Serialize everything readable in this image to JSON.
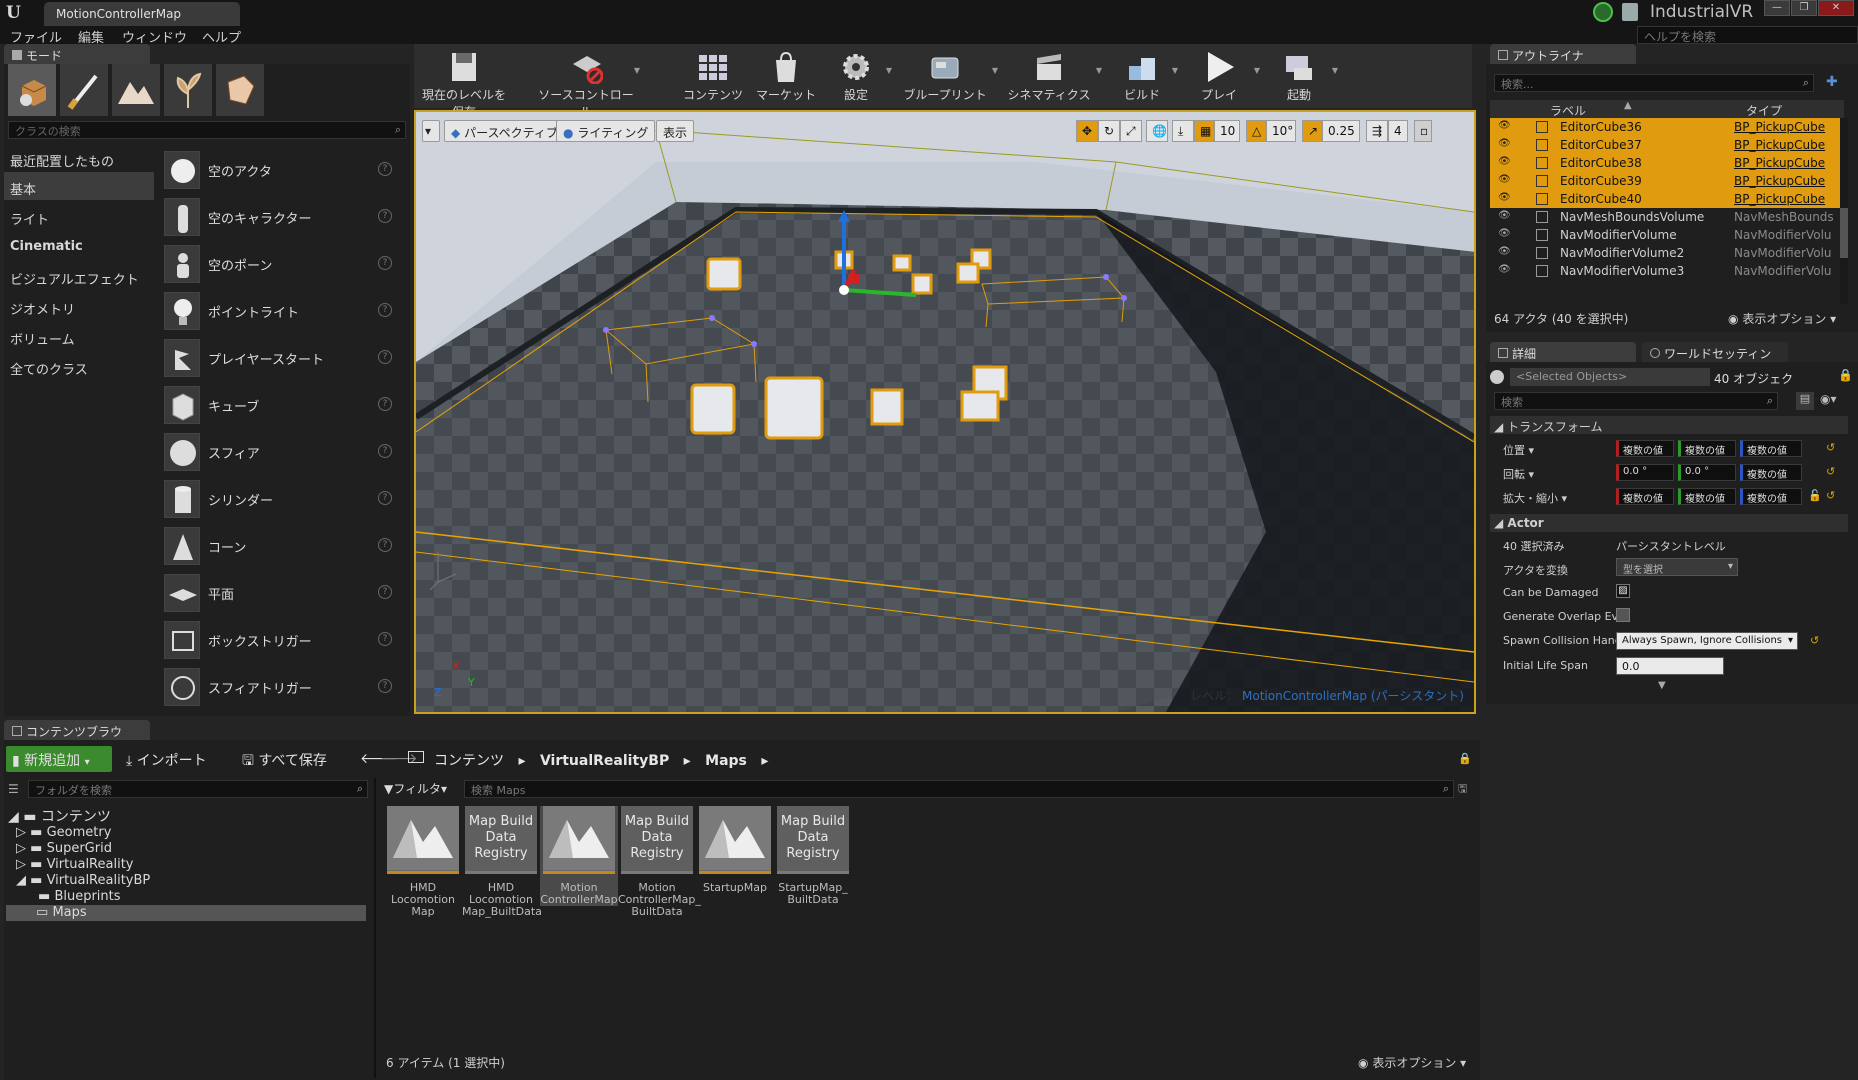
{
  "titlebar": {
    "document_tab": "MotionControllerMap",
    "project_name": "IndustrialVR"
  },
  "menu": [
    "ファイル",
    "編集",
    "ウィンドウ",
    "ヘルプ"
  ],
  "help_search_placeholder": "ヘルプを検索",
  "modes": {
    "tab": "モード",
    "class_search_placeholder": "クラスの検索",
    "categories": [
      "最近配置したもの",
      "基本",
      "ライト",
      "Cinematic",
      "ビジュアルエフェクト",
      "ジオメトリ",
      "ボリューム",
      "全てのクラス"
    ],
    "selected_category": "基本",
    "items": [
      "空のアクタ",
      "空のキャラクター",
      "空のポーン",
      "ポイントライト",
      "プレイヤースタート",
      "キューブ",
      "スフィア",
      "シリンダー",
      "コーン",
      "平面",
      "ボックストリガー",
      "スフィアトリガー"
    ],
    "help_glyph": "?"
  },
  "toolbar": {
    "buttons": [
      "現在のレベルを保存",
      "ソースコントロール",
      "コンテンツ",
      "マーケット",
      "設定",
      "ブループリント",
      "シネマティクス",
      "ビルド",
      "プレイ",
      "起動"
    ]
  },
  "viewport": {
    "perspective": "パースペクティブ",
    "lighting": "ライティング",
    "show": "表示",
    "grid_snap": "10",
    "rotation_snap": "10°",
    "scale_snap": "0.25",
    "camera_speed": "4",
    "level_prefix": "レベル：",
    "level_name": "MotionControllerMap (パーシスタント)",
    "axis_x": "X",
    "axis_y": "Y",
    "axis_z": "Z"
  },
  "outliner": {
    "tab": "アウトライナ",
    "search_placeholder": "検索...",
    "col_label": "ラベル",
    "col_type": "タイプ",
    "rows": [
      {
        "name": "EditorCube36",
        "type": "BP_PickupCube",
        "selected": true
      },
      {
        "name": "EditorCube37",
        "type": "BP_PickupCube",
        "selected": true
      },
      {
        "name": "EditorCube38",
        "type": "BP_PickupCube",
        "selected": true
      },
      {
        "name": "EditorCube39",
        "type": "BP_PickupCube",
        "selected": true
      },
      {
        "name": "EditorCube40",
        "type": "BP_PickupCube",
        "selected": true
      },
      {
        "name": "NavMeshBoundsVolume",
        "type": "NavMeshBounds",
        "selected": false
      },
      {
        "name": "NavModifierVolume",
        "type": "NavModifierVolu",
        "selected": false
      },
      {
        "name": "NavModifierVolume2",
        "type": "NavModifierVolu",
        "selected": false
      },
      {
        "name": "NavModifierVolume3",
        "type": "NavModifierVolu",
        "selected": false
      }
    ],
    "footer": "64 アクタ (40 を選択中)",
    "view_options": "表示オプション"
  },
  "details": {
    "tab": "詳細",
    "world_tab": "ワールドセッティン",
    "selected_objects": "<Selected Objects>",
    "object_count": "40 オブジェク",
    "search_placeholder": "検索",
    "transform_header": "トランスフォーム",
    "location_label": "位置",
    "rotation_label": "回転",
    "scale_label": "拡大・縮小",
    "multi_value": "複数の値",
    "rot_x": "0.0 °",
    "rot_y": "0.0 °",
    "actor_header": "Actor",
    "selected_count_label": "40 選択済み",
    "selected_level": "パーシスタントレベル",
    "convert_actor_label": "アクタを変換",
    "convert_actor_value": "型を選択",
    "can_be_damaged_label": "Can be Damaged",
    "gen_overlap_label": "Generate Overlap Eve",
    "spawn_collision_label": "Spawn Collision Hanc",
    "spawn_collision_value": "Always Spawn, Ignore Collisions",
    "initial_life_label": "Initial Life Span",
    "initial_life_value": "0.0"
  },
  "content_browser": {
    "tab": "コンテンツブラウ",
    "add_new": "新規追加",
    "import": "インポート",
    "save_all": "すべて保存",
    "path": [
      "コンテンツ",
      "VirtualRealityBP",
      "Maps"
    ],
    "folder_search_placeholder": "フォルダを検索",
    "filter": "フィルタ",
    "asset_search_placeholder": "検索 Maps",
    "tree": {
      "root": "コンテンツ",
      "children": [
        "Geometry",
        "SuperGrid",
        "VirtualReality",
        "VirtualRealityBP"
      ],
      "bp_children": [
        "Blueprints",
        "Maps"
      ]
    },
    "assets": [
      {
        "name": "HMD Locomotion Map",
        "kind": "map",
        "selected": false
      },
      {
        "name": "HMD Locomotion Map_BuiltData",
        "kind": "registry",
        "selected": false
      },
      {
        "name": "Motion ControllerMap",
        "kind": "map",
        "selected": true
      },
      {
        "name": "Motion ControllerMap_ BuiltData",
        "kind": "registry",
        "selected": false
      },
      {
        "name": "StartupMap",
        "kind": "map",
        "selected": false
      },
      {
        "name": "StartupMap_ BuiltData",
        "kind": "registry",
        "selected": false
      }
    ],
    "registry_label": "Map Build Data Registry",
    "item_count": "6 アイテム (1 選択中)",
    "view_options": "表示オプション"
  },
  "colors": {
    "selection": "#e09c0e",
    "accent_gold": "#c9a31c",
    "add_new_green": "#3c8a2e"
  }
}
